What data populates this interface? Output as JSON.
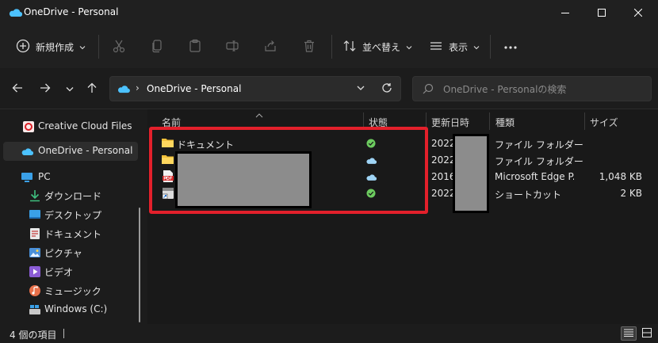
{
  "window": {
    "title": "OneDrive - Personal"
  },
  "toolbar": {
    "new_label": "新規作成",
    "sort_label": "並べ替え",
    "view_label": "表示"
  },
  "address": {
    "path": "OneDrive - Personal"
  },
  "search": {
    "placeholder": "OneDrive - Personalの検索"
  },
  "sidebar": {
    "items": [
      {
        "label": "Creative Cloud Files",
        "icon": "creative-cloud-icon"
      },
      {
        "label": "OneDrive - Personal",
        "icon": "onedrive-icon",
        "selected": true
      },
      {
        "label": "PC",
        "icon": "pc-icon"
      },
      {
        "label": "ダウンロード",
        "icon": "download-icon"
      },
      {
        "label": "デスクトップ",
        "icon": "desktop-icon"
      },
      {
        "label": "ドキュメント",
        "icon": "documents-icon"
      },
      {
        "label": "ピクチャ",
        "icon": "pictures-icon"
      },
      {
        "label": "ビデオ",
        "icon": "videos-icon"
      },
      {
        "label": "ミュージック",
        "icon": "music-icon"
      },
      {
        "label": "Windows (C:)",
        "icon": "drive-icon"
      }
    ]
  },
  "columns": {
    "name": "名前",
    "status": "状態",
    "date": "更新日時",
    "type": "種類",
    "size": "サイズ"
  },
  "files": [
    {
      "name": "ドキュメント",
      "status": "synced",
      "date": "2022/",
      "type": "ファイル フォルダー",
      "size": ""
    },
    {
      "name": "",
      "status": "cloud",
      "date": "2022/",
      "type": "ファイル フォルダー",
      "size": ""
    },
    {
      "name": "",
      "status": "cloud",
      "date": "2016/",
      "type": "Microsoft Edge P...",
      "size": "1,048 KB"
    },
    {
      "name": "",
      "status": "synced",
      "date": "2022/",
      "type": "ショートカット",
      "size": "2 KB"
    }
  ],
  "statusbar": {
    "item_count": "4 個の項目"
  },
  "colors": {
    "accent": "#4cc2ff",
    "synced": "#6ccb5f",
    "folder": "#f3c13a",
    "highlight": "#e3202b"
  }
}
